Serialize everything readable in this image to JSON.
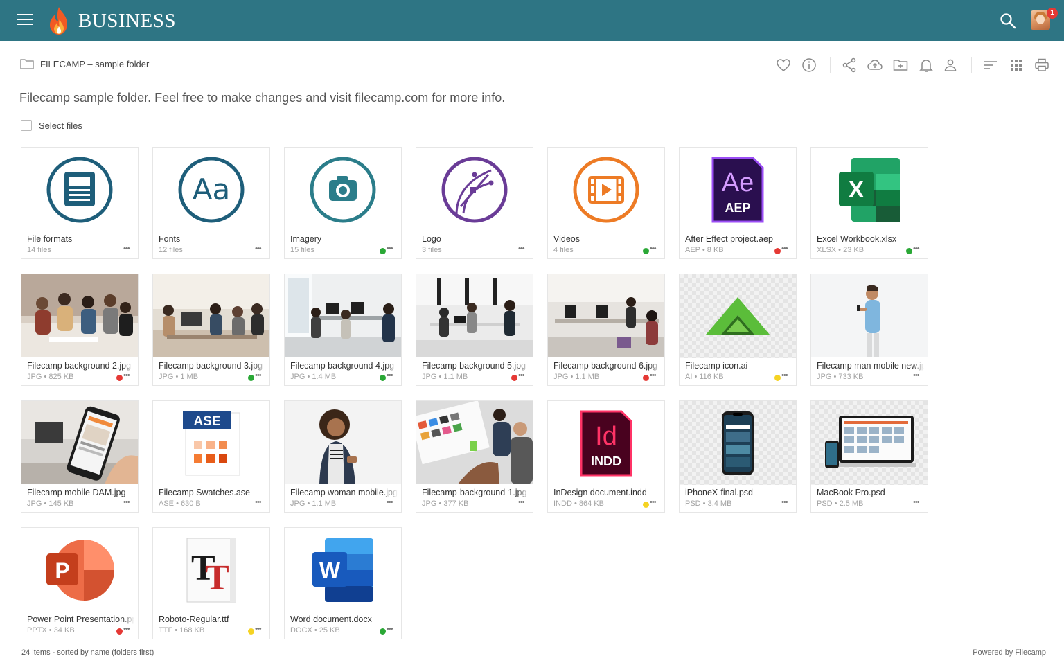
{
  "header": {
    "brand": "BUSINESS",
    "notification_count": "1"
  },
  "breadcrumb": {
    "path": "FILECAMP – sample folder"
  },
  "toolbar": {
    "icons": [
      "heart-icon",
      "info-icon",
      "share-icon",
      "upload-cloud-icon",
      "new-folder-icon",
      "bell-icon",
      "user-icon",
      "sort-icon",
      "grid-view-icon",
      "print-icon"
    ]
  },
  "description": {
    "before": "Filecamp sample folder. Feel free to make changes and visit ",
    "link": "filecamp.com",
    "after": " for more info."
  },
  "select_files": "Select files",
  "items": [
    {
      "name": "File formats",
      "meta": "14 files",
      "status": null,
      "kind": "folder-fileformats"
    },
    {
      "name": "Fonts",
      "meta": "12 files",
      "status": null,
      "kind": "folder-fonts"
    },
    {
      "name": "Imagery",
      "meta": "15 files",
      "status": "green",
      "kind": "folder-imagery"
    },
    {
      "name": "Logo",
      "meta": "3 files",
      "status": null,
      "kind": "folder-logo"
    },
    {
      "name": "Videos",
      "meta": "4 files",
      "status": "green",
      "kind": "folder-videos"
    },
    {
      "name": "After Effect project.aep",
      "meta": "AEP • 8 KB",
      "status": "red",
      "kind": "aep"
    },
    {
      "name": "Excel Workbook.xlsx",
      "meta": "XLSX • 23 KB",
      "status": "green",
      "kind": "xlsx"
    },
    {
      "name": "Filecamp background 2.jpg",
      "meta": "JPG • 825 KB",
      "status": "red",
      "kind": "photo1"
    },
    {
      "name": "Filecamp background 3.jpg",
      "meta": "JPG • 1 MB",
      "status": "green",
      "kind": "photo2"
    },
    {
      "name": "Filecamp background 4.jpg",
      "meta": "JPG • 1.4 MB",
      "status": "green",
      "kind": "photo3"
    },
    {
      "name": "Filecamp background 5.jpg",
      "meta": "JPG • 1.1 MB",
      "status": "red",
      "kind": "photo4"
    },
    {
      "name": "Filecamp background 6.jpg",
      "meta": "JPG • 1.1 MB",
      "status": "red",
      "kind": "photo5"
    },
    {
      "name": "Filecamp icon.ai",
      "meta": "AI • 116 KB",
      "status": "yellow",
      "kind": "ai"
    },
    {
      "name": "Filecamp man mobile new.jpg",
      "meta": "JPG • 733 KB",
      "status": null,
      "kind": "photo-man"
    },
    {
      "name": "Filecamp mobile DAM.jpg",
      "meta": "JPG • 145 KB",
      "status": null,
      "kind": "photo-mobile"
    },
    {
      "name": "Filecamp Swatches.ase",
      "meta": "ASE • 630 B",
      "status": null,
      "kind": "ase"
    },
    {
      "name": "Filecamp woman mobile.jpg",
      "meta": "JPG • 1.1 MB",
      "status": null,
      "kind": "photo-woman"
    },
    {
      "name": "Filecamp-background-1.jpg",
      "meta": "JPG • 377 KB",
      "status": null,
      "kind": "photo-bg1"
    },
    {
      "name": "InDesign document.indd",
      "meta": "INDD • 864 KB",
      "status": "yellow",
      "kind": "indd"
    },
    {
      "name": "iPhoneX-final.psd",
      "meta": "PSD • 3.4 MB",
      "status": null,
      "kind": "iphone"
    },
    {
      "name": "MacBook Pro.psd",
      "meta": "PSD • 2.5 MB",
      "status": null,
      "kind": "macbook"
    },
    {
      "name": "Power Point Presentation.pptx",
      "meta": "PPTX • 34 KB",
      "status": "red",
      "kind": "pptx"
    },
    {
      "name": "Roboto-Regular.ttf",
      "meta": "TTF • 168 KB",
      "status": "yellow",
      "kind": "ttf"
    },
    {
      "name": "Word document.docx",
      "meta": "DOCX • 25 KB",
      "status": "green",
      "kind": "docx"
    }
  ],
  "status_colors": {
    "green": "#2aa836",
    "red": "#e53935",
    "yellow": "#f5d323"
  },
  "icon_labels": {
    "aep_big": "Ae",
    "aep_small": "AEP",
    "excel": "X",
    "ase": "ASE",
    "indd_big": "Id",
    "indd_small": "INDD",
    "pptx": "P",
    "word": "W",
    "fonts": "Aa"
  },
  "footer": {
    "summary": "24 items - sorted by name (folders first)",
    "powered": "Powered by Filecamp"
  }
}
